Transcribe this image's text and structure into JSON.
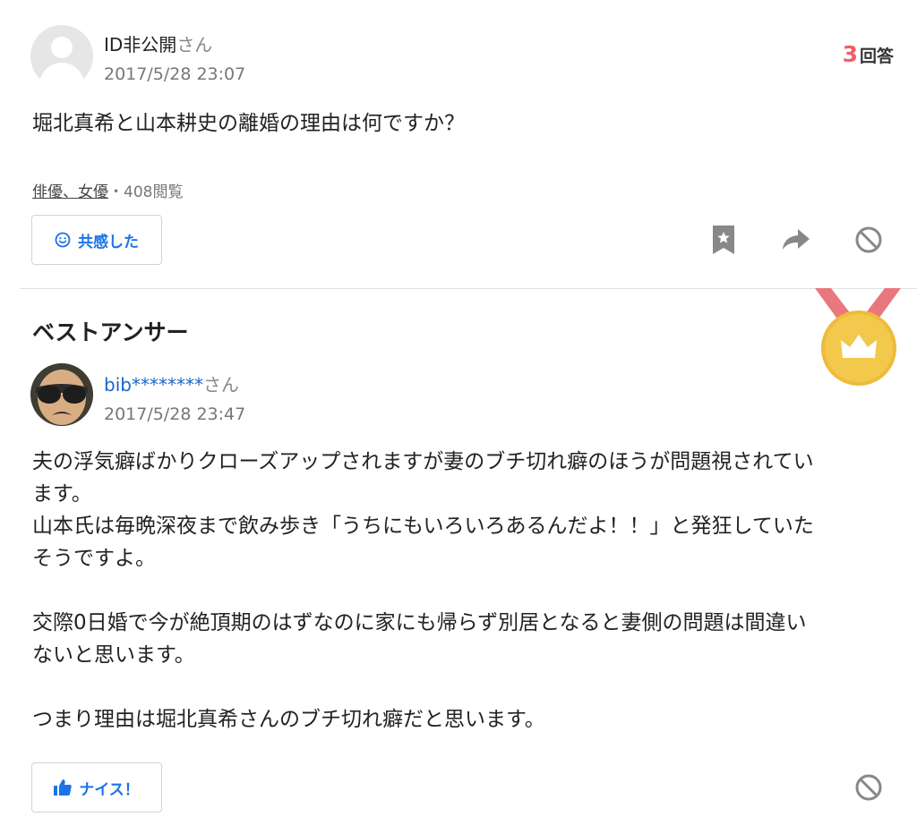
{
  "question": {
    "user_name": "ID非公開",
    "user_suffix": "さん",
    "date": "2017/5/28 23:07",
    "answer_count": "3",
    "answer_count_label": "回答",
    "text": "堀北真希と山本耕史の離婚の理由は何ですか？",
    "category": "俳優、女優",
    "views": "・408閲覧",
    "empathy_button": "共感した"
  },
  "best_answer": {
    "label": "ベストアンサー",
    "user_name": "bib********",
    "user_suffix": "さん",
    "date": "2017/5/28 23:47",
    "lines": [
      "夫の浮気癖ばかりクローズアップされますが妻のブチ切れ癖のほうが問題視されてい",
      "ます。",
      "山本氏は毎晩深夜まで飲み歩き「うちにもいろいろあるんだよ！！」と発狂していた",
      "そうですよ。",
      "",
      "交際0日婚で今が絶頂期のはずなのに家にも帰らず別居となると妻側の問題は間違い",
      "ないと思います。",
      "",
      "つまり理由は堀北真希さんのブチ切れ癖だと思います。"
    ],
    "nice_button": "ナイス！"
  },
  "icons": {
    "avatar": "default-user-icon",
    "bookmark": "bookmark-star-icon",
    "share": "share-arrow-icon",
    "block": "block-icon",
    "smile": "smile-icon",
    "thumbs_up": "thumbs-up-icon",
    "medal": "best-answer-medal-icon"
  },
  "colors": {
    "accent_blue": "#1a73e8",
    "answer_count_red": "#ee5e6b",
    "medal_ribbon": "#e8787e",
    "medal_gold": "#f2c94c"
  }
}
